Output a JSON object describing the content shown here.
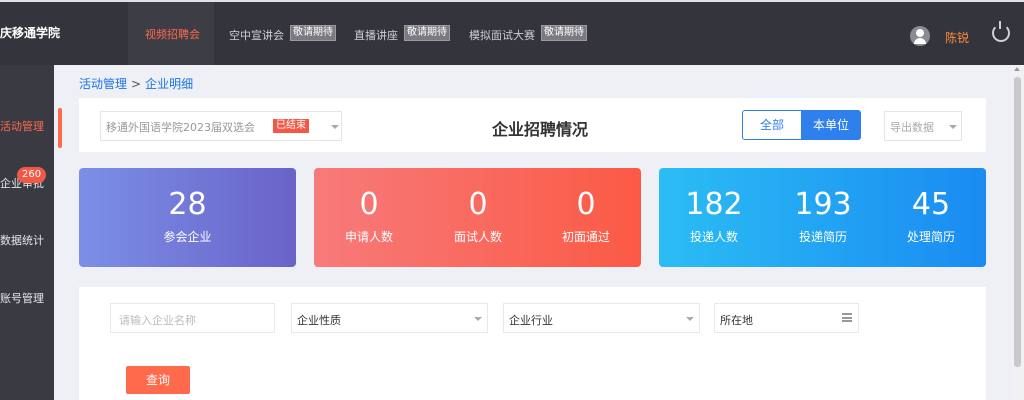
{
  "app": {
    "title": "庆移通学院"
  },
  "nav": {
    "active": "视频招聘会",
    "items": [
      {
        "label": "空中宣讲会",
        "badge": "敬请期待"
      },
      {
        "label": "直播讲座",
        "badge": "敬请期待"
      },
      {
        "label": "模拟面试大赛",
        "badge": "敬请期待"
      }
    ]
  },
  "user": {
    "name": "陈锐"
  },
  "sidebar": {
    "items": [
      {
        "label": "活动管理"
      },
      {
        "label": "企业审批",
        "count": "260"
      },
      {
        "label": "数据统计"
      },
      {
        "label": "账号管理"
      }
    ]
  },
  "breadcrumb": {
    "parent": "活动管理",
    "sep": ">",
    "current": "企业明细"
  },
  "toolbar": {
    "event_select": "移通外国语学院2023届双选会",
    "event_status": "已结束",
    "title": "企业招聘情况",
    "scope_all": "全部",
    "scope_unit": "本单位",
    "export": "导出数据"
  },
  "stats": {
    "card1": [
      {
        "value": "28",
        "label": "参会企业"
      }
    ],
    "card2": [
      {
        "value": "0",
        "label": "申请人数"
      },
      {
        "value": "0",
        "label": "面试人数"
      },
      {
        "value": "0",
        "label": "初面通过"
      }
    ],
    "card3": [
      {
        "value": "182",
        "label": "投递人数"
      },
      {
        "value": "193",
        "label": "投递简历"
      },
      {
        "value": "45",
        "label": "处理简历"
      }
    ]
  },
  "filters": {
    "company_placeholder": "请输入企业名称",
    "nature": "企业性质",
    "industry": "企业行业",
    "location": "所在地",
    "query": "查询"
  },
  "colors": {
    "accent": "#ff6a4d",
    "primary": "#2f80ed",
    "topbar": "#34343c"
  }
}
